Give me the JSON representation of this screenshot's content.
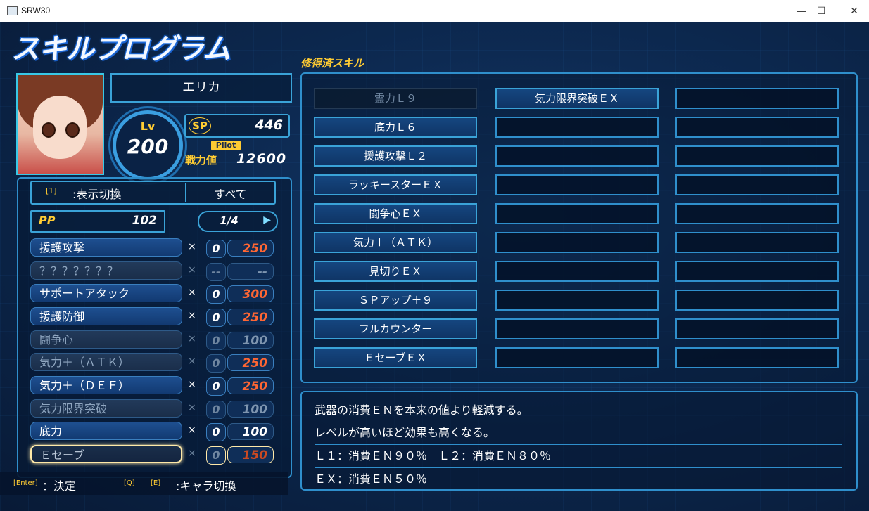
{
  "window": {
    "title": "SRW30",
    "minimize": "—",
    "maximize": "☐",
    "close": "✕"
  },
  "screen_title": "スキルプログラム",
  "acquired_title": "修得済スキル",
  "pilot": {
    "name": "エリカ",
    "lv_label": "Lv",
    "level": "200",
    "sp_label": "SP",
    "sp": "446",
    "pilot_badge": "Pilot",
    "power_label": "戦力値",
    "power": "12600"
  },
  "toggle": {
    "key": "[1]",
    "label": ":表示切換",
    "value": "すべて"
  },
  "pp": {
    "label": "PP",
    "value": "102"
  },
  "page": {
    "value": "1/4",
    "arrow": "▶"
  },
  "skills": [
    {
      "name": "援護攻撃",
      "mult": "×",
      "count": "0",
      "cost": "250",
      "state": "normal"
    },
    {
      "name": "？？？？？？？",
      "mult": "×",
      "count": "--",
      "cost": "--",
      "state": "dim"
    },
    {
      "name": "サポートアタック",
      "mult": "×",
      "count": "0",
      "cost": "300",
      "state": "normal"
    },
    {
      "name": "援護防御",
      "mult": "×",
      "count": "0",
      "cost": "250",
      "state": "normal"
    },
    {
      "name": "闘争心",
      "mult": "×",
      "count": "0",
      "cost": "100",
      "state": "dim"
    },
    {
      "name": "気力＋（ＡＴＫ）",
      "mult": "×",
      "count": "0",
      "cost": "250",
      "state": "dimcost"
    },
    {
      "name": "気力＋（ＤＥＦ）",
      "mult": "×",
      "count": "0",
      "cost": "250",
      "state": "normal"
    },
    {
      "name": "気力限界突破",
      "mult": "×",
      "count": "0",
      "cost": "100",
      "state": "dim"
    },
    {
      "name": "底力",
      "mult": "×",
      "count": "0",
      "cost": "100",
      "state": "normal"
    },
    {
      "name": "Ｅセーブ",
      "mult": "×",
      "count": "0",
      "cost": "150",
      "state": "sel"
    }
  ],
  "acquired": {
    "col1": [
      "霊力Ｌ９",
      "底力Ｌ６",
      "援護攻撃Ｌ２",
      "ラッキースターＥＸ",
      "闘争心ＥＸ",
      "気力＋（ＡＴＫ）",
      "見切りＥＸ",
      "ＳＰアップ＋９",
      "フルカウンター",
      "ＥセーブＥＸ"
    ],
    "col2": [
      "気力限界突破ＥＸ",
      "",
      "",
      "",
      "",
      "",
      "",
      "",
      "",
      ""
    ],
    "col3": [
      "",
      "",
      "",
      "",
      "",
      "",
      "",
      "",
      "",
      ""
    ]
  },
  "description": [
    "武器の消費ＥＮを本来の値より軽減する。",
    "レベルが高いほど効果も高くなる。",
    "Ｌ１：消費ＥＮ９０％　Ｌ２：消費ＥＮ８０％",
    "ＥＸ：消費ＥＮ５０％"
  ],
  "footer": {
    "enter_key": "[Enter]",
    "enter_label": "：決定",
    "q_key": "[Q]",
    "e_key": "[E]",
    "switch_label": ":キャラ切換"
  }
}
